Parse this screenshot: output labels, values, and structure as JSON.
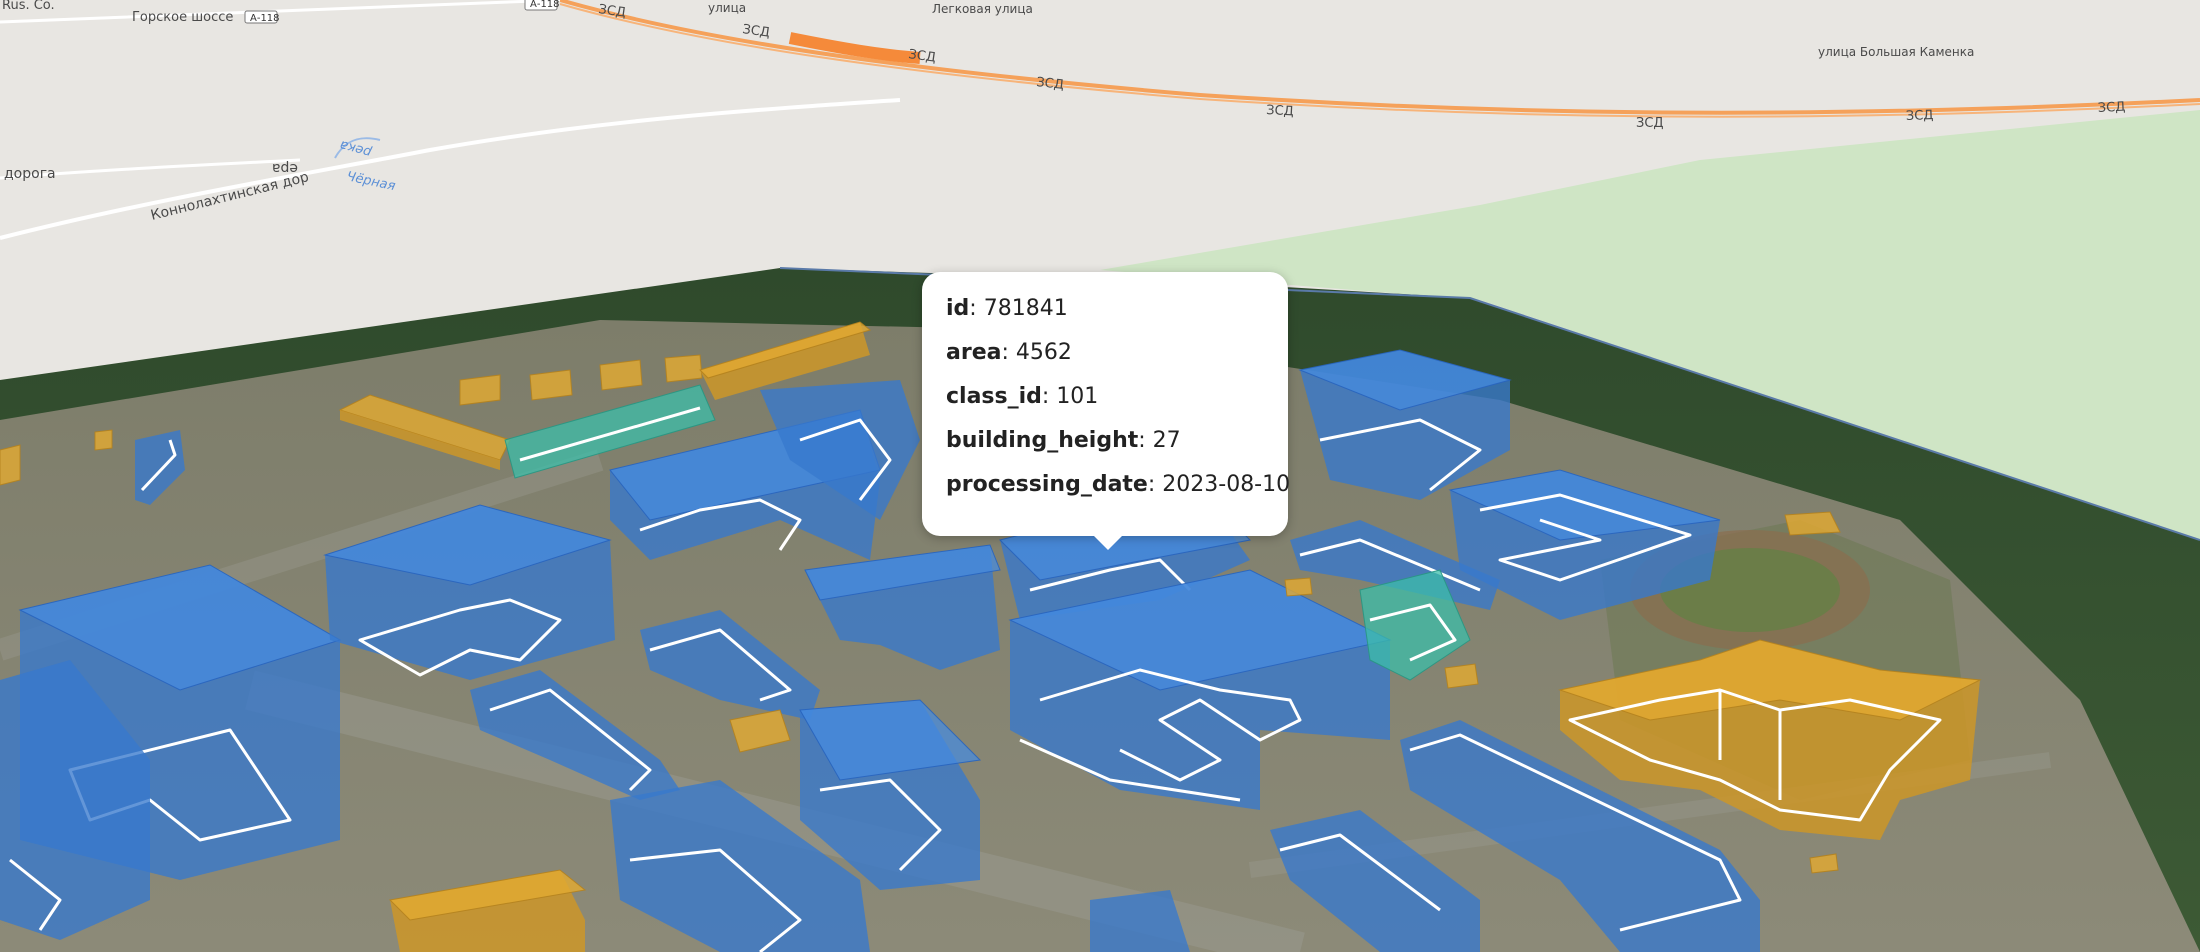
{
  "map": {
    "labels": {
      "attribution": "Rus. Co.",
      "road_gorskoe": "Горское шоссе",
      "shield_a118_1": "А-118",
      "shield_a118_2": "А-118",
      "street_ulitsa": "улица",
      "street_legkovaya": "Легковая улица",
      "street_bolshaya_kamenka": "улица Большая Каменка",
      "zsd": "ЗСД",
      "road_doroga": "дорога",
      "road_konnolakhtinskaya": "Коннолахтинская дор",
      "frag_era": "ера",
      "river_reka": "река",
      "river_chernaya": "Чёрная"
    },
    "layer_colors": {
      "residential": "#468ce1",
      "commercial": "#e2aa32",
      "public": "#3cbeaa",
      "outline": "#ffffff",
      "forest_park": "#cfe5c5",
      "highway": "#f5a15a"
    }
  },
  "popup": {
    "rows": [
      {
        "key": "id",
        "value": "781841"
      },
      {
        "key": "area",
        "value": "4562"
      },
      {
        "key": "class_id",
        "value": "101"
      },
      {
        "key": "building_height",
        "value": "27"
      },
      {
        "key": "processing_date",
        "value": "2023-08-10"
      }
    ]
  }
}
